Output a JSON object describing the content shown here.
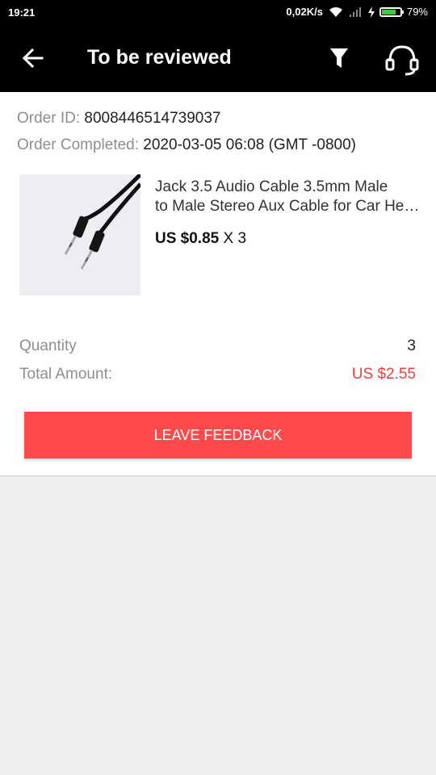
{
  "status_bar": {
    "time": "19:21",
    "network_speed": "0,02K/s",
    "battery_percent": "79%",
    "battery_level": 0.79
  },
  "app_bar": {
    "title": "To be reviewed",
    "icons": [
      "back-arrow-icon",
      "filter-icon",
      "headset-support-icon"
    ]
  },
  "order": {
    "id_label": "Order ID:",
    "id_value": "8008446514739037",
    "completed_label": "Order Completed:",
    "completed_value": "2020-03-05 06:08 (GMT -0800)"
  },
  "product": {
    "title_line1": "Jack 3.5 Audio Cable 3.5mm Male",
    "title_line2": "to Male Stereo Aux Cable for Car Headphone",
    "price": "US $0.85",
    "multiplier": "X 3"
  },
  "summary": {
    "quantity_label": "Quantity",
    "quantity_value": "3",
    "total_label": "Total Amount:",
    "total_value": "US $2.55"
  },
  "actions": {
    "leave_feedback": "LEAVE FEEDBACK"
  },
  "colors": {
    "app_bar": "#000000",
    "accent_button": "#fe4a4b",
    "total_price": "#e8443f",
    "battery_fill": "#3ccb3c"
  }
}
